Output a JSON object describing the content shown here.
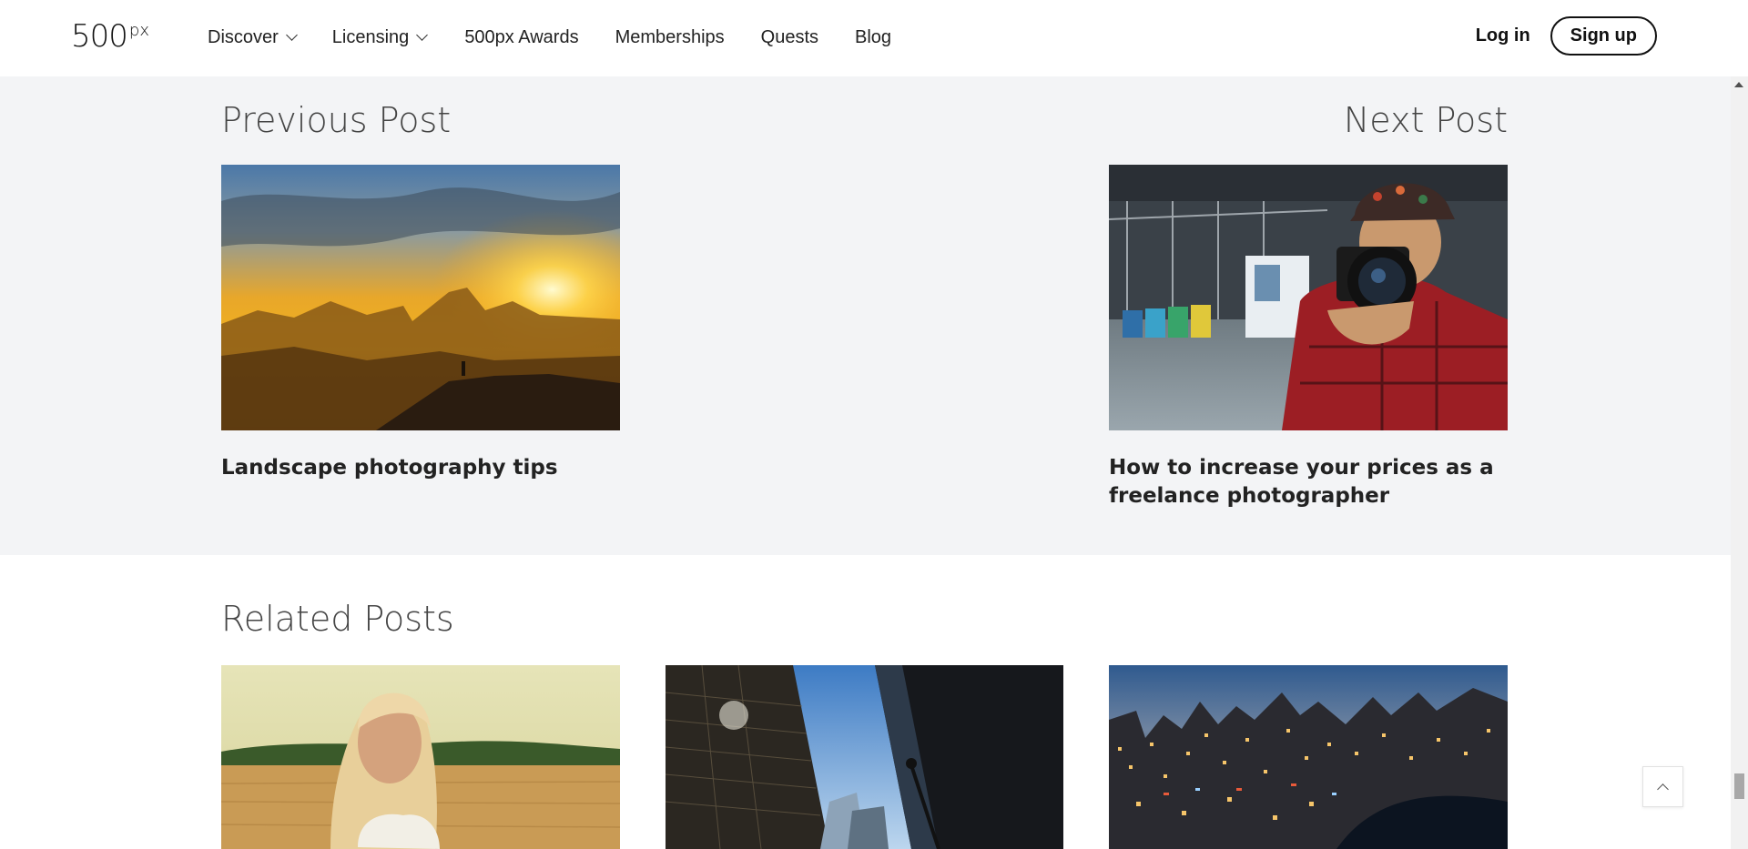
{
  "header": {
    "logo_text": "500",
    "logo_sup": "px",
    "nav": [
      {
        "label": "Discover",
        "has_dropdown": true
      },
      {
        "label": "Licensing",
        "has_dropdown": true
      },
      {
        "label": "500px Awards",
        "has_dropdown": false
      },
      {
        "label": "Memberships",
        "has_dropdown": false
      },
      {
        "label": "Quests",
        "has_dropdown": false
      },
      {
        "label": "Blog",
        "has_dropdown": false
      }
    ],
    "login_label": "Log in",
    "signup_label": "Sign up"
  },
  "post_nav": {
    "previous": {
      "heading": "Previous Post",
      "title": "Landscape photography tips",
      "image": "sunset-mountain-landscape"
    },
    "next": {
      "heading": "Next Post",
      "title_line1": "How to increase your prices as a",
      "title_line2": "freelance photographer",
      "image": "photographer-with-camera"
    }
  },
  "related": {
    "heading": "Related Posts",
    "posts": [
      {
        "image": "woman-in-wheat-field"
      },
      {
        "image": "skyscrapers-looking-up"
      },
      {
        "image": "city-skyline-at-night"
      }
    ]
  },
  "icons": {
    "back_to_top": "chevron-up-icon",
    "dropdown": "chevron-down-icon"
  },
  "colors": {
    "section_bg": "#f3f4f6",
    "text_dark": "#222222"
  }
}
